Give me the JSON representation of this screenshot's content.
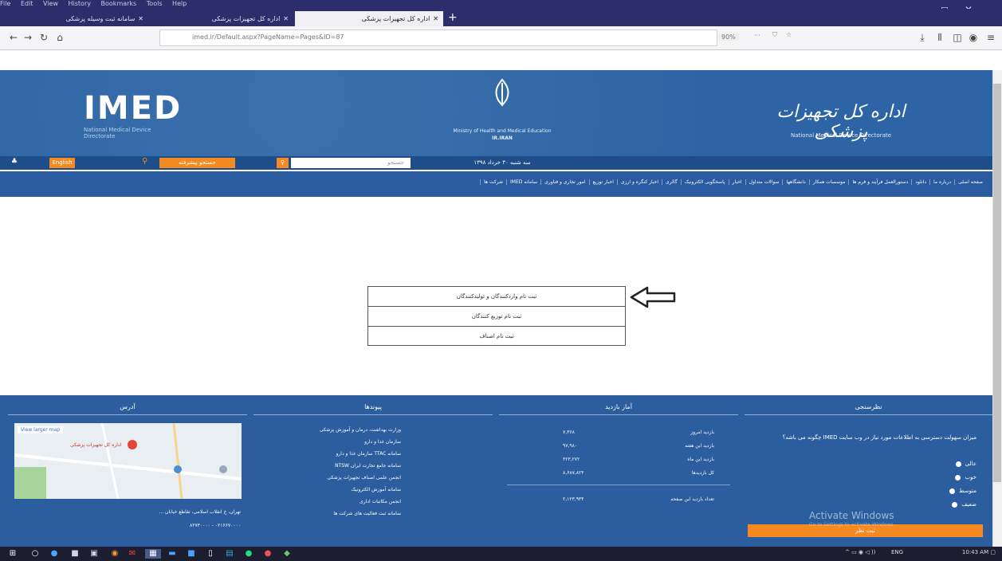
{
  "browser": {
    "menu": [
      "File",
      "Edit",
      "View",
      "History",
      "Bookmarks",
      "Tools",
      "Help"
    ],
    "tabs": [
      {
        "label": "سامانه ثبت وسیله پزشکی"
      },
      {
        "label": "اداره کل تجهیزات پزشکی"
      },
      {
        "label": "اداره کل تجهیزات پزشکی"
      }
    ],
    "url": "imed.ir/Default.aspx?PageName=Pages&ID=87",
    "zoom": "90%"
  },
  "site": {
    "logo_text": "IMED",
    "logo_sub": "National Medical Device Directorate",
    "ministry_en": "Ministry of Health and Medical Education",
    "country": "IR.IRAN",
    "brand_fa": "اداره کل تجهیزات پزشکی",
    "brand_en": "National Medical Device Directorate",
    "english_btn": "English",
    "search_placeholder": "جستجو",
    "search_btn": "جستجو پیشرفته",
    "date": "سه شنبه ۳۰ خرداد ۱۳۹۸"
  },
  "nav": [
    "صفحه اصلی",
    "درباره ما",
    "دانلود",
    "دستورالعمل فرآیند و فرم ها",
    "موسسات همکار",
    "دانشگاهها",
    "سوالات متداول",
    "اخبار",
    "پاسخگویی الکترونیک",
    "گالری",
    "اخبار کنگره و ارزی",
    "اخبار توزیع",
    "امور تجاری و فناوری",
    "سامانه IMED",
    "شرکت ها"
  ],
  "center_links": [
    "ثبت نام واردکنندگان و تولیدکنندگان",
    "ثبت نام توزیع کنندگان",
    "ثبت نام اصناف"
  ],
  "footer": {
    "address": {
      "title": "آدرس",
      "map_label": "اداره کل تجهیزات پزشکی",
      "map_link": "View larger map",
      "line1": "تهران، خ انقلاب اسلامی، تقاطع خیابان ...",
      "phone": "۰۲۱۶۶۷۰۰۰۰ - ۸۲۷۳۰۰۰۰"
    },
    "links": {
      "title": "پیوندها",
      "items": [
        "وزارت بهداشت، درمان و آموزش پزشکی",
        "سازمان غذا و دارو",
        "سامانه TTAC سازمان غذا و دارو",
        "سامانه جامع تجارت ایران NTSW",
        "انجمن علمی اصناف تجهیزات پزشکی",
        "سامانه آموزش الکترونیک",
        "انجمن مکاتبات اداری",
        "سامانه ثبت فعالیت های شرکت ها"
      ]
    },
    "stats": {
      "title": "آمار بازدید",
      "rows": [
        {
          "label": "بازدید امروز",
          "value": "۷,۳۶۸"
        },
        {
          "label": "بازدید این هفته",
          "value": "۹۷,۹۸۰"
        },
        {
          "label": "بازدید این ماه",
          "value": "۳۲۳,۲۷۲"
        },
        {
          "label": "کل بازدیدها",
          "value": "۸,۶۸۷,۸۲۴"
        }
      ],
      "online_label": "تعداد بازدید این صفحه",
      "online_value": "۲,۱۲۳,۹۳۴"
    },
    "poll": {
      "title": "نظرسنجی",
      "question": "میزان سهولت دسترسی به اطلاعات مورد نیاز در وب سایت IMED چگونه می باشد؟",
      "options": [
        "عالی",
        "خوب",
        "متوسط",
        "ضعیف"
      ],
      "button": "ثبت نظر"
    }
  },
  "overlay": {
    "activate_title": "Activate Windows",
    "activate_sub": "Go to Settings to activate Windows."
  },
  "taskbar": {
    "time": "10:43 AM",
    "lang": "ENG"
  },
  "colors": {
    "header_blue": "#2c64a5",
    "nav_blue": "#2a5ba0",
    "accent_orange": "#f38a22",
    "chrome_purple": "#2b2e6a"
  }
}
